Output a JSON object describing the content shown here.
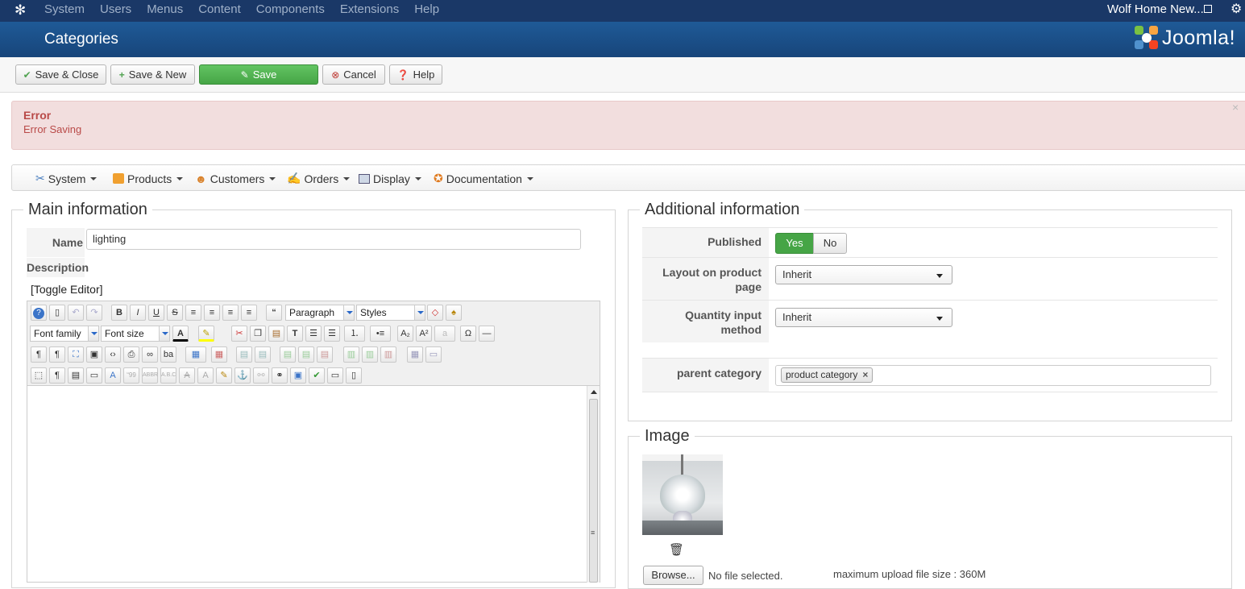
{
  "topnav": {
    "menu": [
      "System",
      "Users",
      "Menus",
      "Content",
      "Components",
      "Extensions",
      "Help"
    ],
    "site_name": "Wolf Home New..."
  },
  "header": {
    "title": "Categories",
    "brand": "Joomla!"
  },
  "toolbar": {
    "save_close": "Save & Close",
    "save_new": "Save & New",
    "save": "Save",
    "cancel": "Cancel",
    "help": "Help"
  },
  "alert": {
    "heading": "Error",
    "message": "Error Saving",
    "close": "×"
  },
  "vm_menu": [
    "System",
    "Products",
    "Customers",
    "Orders",
    "Display",
    "Documentation"
  ],
  "main": {
    "legend": "Main information",
    "name_label": "Name",
    "name_value": "lighting",
    "description_label": "Description",
    "toggle_editor": "[Toggle Editor]",
    "format_select": "Paragraph",
    "styles_select": "Styles",
    "font_family": "Font family",
    "font_size": "Font size"
  },
  "additional": {
    "legend": "Additional information",
    "published_label": "Published",
    "yes": "Yes",
    "no": "No",
    "published_value": "Yes",
    "layout_label": "Layout on product page",
    "layout_value": "Inherit",
    "quantity_label": "Quantity input method",
    "quantity_value": "Inherit",
    "parent_label": "parent category",
    "parent_tag": "product category"
  },
  "image": {
    "legend": "Image",
    "browse": "Browse...",
    "no_file": "No file selected.",
    "max_size": "maximum upload file size : 360M"
  },
  "colors": {
    "topnav": "#1a3867",
    "header": "#1d5591",
    "success": "#46a546",
    "error_bg": "#f2dede",
    "error_text": "#b94a48"
  }
}
